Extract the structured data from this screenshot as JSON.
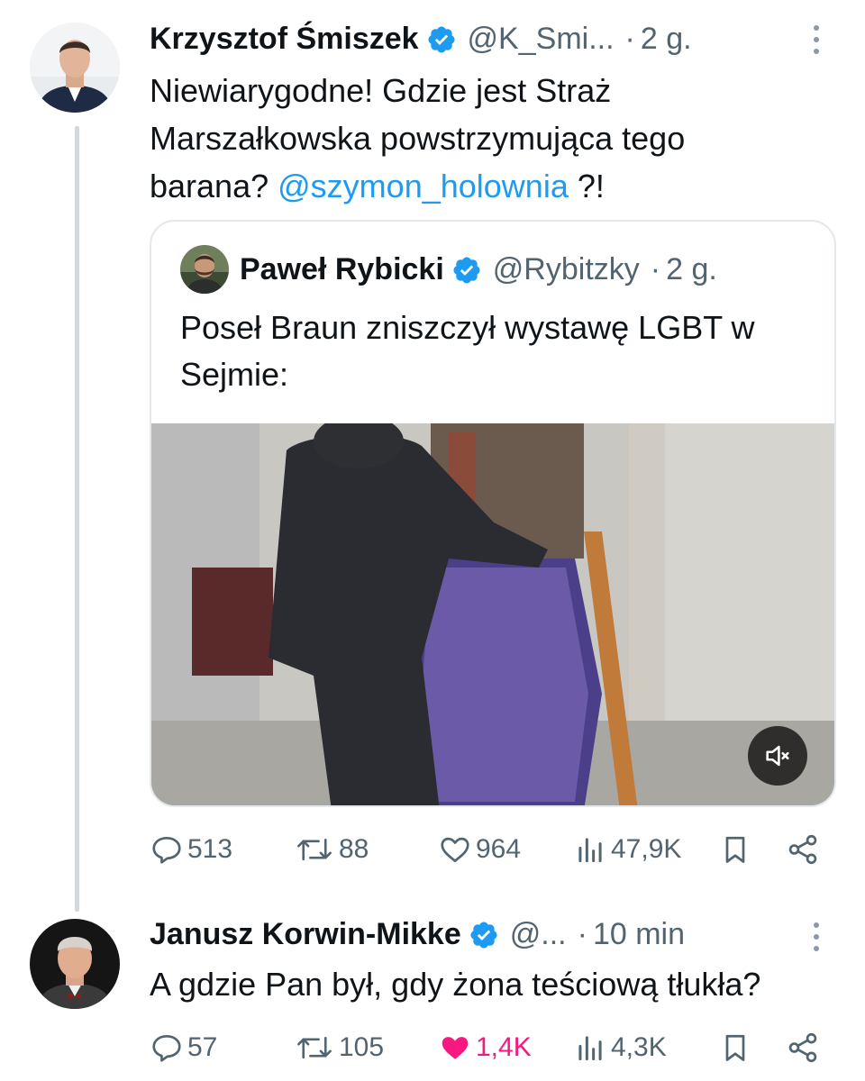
{
  "tweets": [
    {
      "name": "Krzysztof Śmiszek",
      "handle": "@K_Smi...",
      "separator": "·",
      "time": "2 g.",
      "text": "Niewiarygodne! Gdzie jest Straż Marszałkowska powstrzymująca tego barana?",
      "mention": "@szymon_holownia",
      "text_end": " ?!",
      "verified": true
    },
    {
      "name": "Janusz Korwin-Mikke",
      "handle": "@...",
      "separator": "·",
      "time": "10 min",
      "text": "A gdzie Pan był, gdy żona teściową tłukła?",
      "verified": true
    }
  ],
  "quoted": {
    "name": "Paweł Rybicki",
    "handle": "@Rybitzky",
    "separator": "·",
    "time": "2 g.",
    "text": "Poseł Braun zniszczył wystawę LGBT w Sejmie:",
    "verified": true,
    "video": {
      "muted": true,
      "icon": "volume-muted-icon"
    }
  },
  "actions": [
    {
      "replies": "513",
      "retweets": "88",
      "likes": "964",
      "views": "47,9K",
      "liked": false
    },
    {
      "replies": "57",
      "retweets": "105",
      "likes": "1,4K",
      "views": "4,3K",
      "liked": true
    }
  ],
  "colors": {
    "text": "#0f1419",
    "secondary": "#536471",
    "mention": "#1d9bf0",
    "verified": "#1d9bf0",
    "like_active": "#f91880",
    "thread_line": "#cfd9de"
  }
}
